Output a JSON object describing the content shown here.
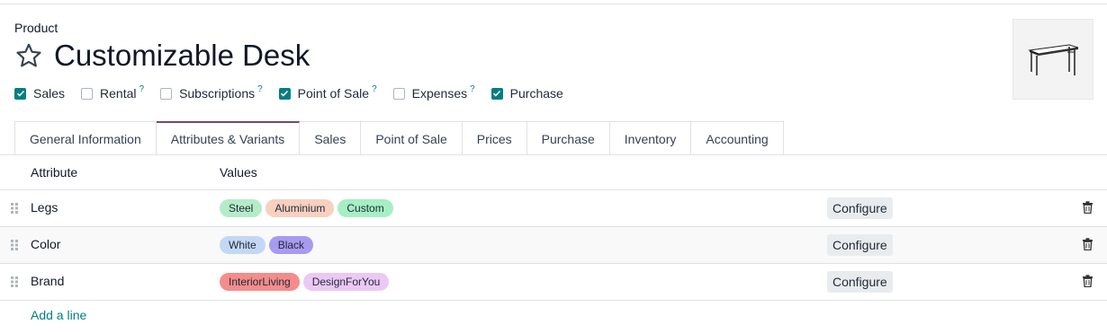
{
  "breadcrumb": "Product",
  "product": {
    "name": "Customizable Desk",
    "favorite_icon": "star-outline-icon",
    "image_icon": "desk-image"
  },
  "options": [
    {
      "label": "Sales",
      "checked": true,
      "help": ""
    },
    {
      "label": "Rental",
      "checked": false,
      "help": "?"
    },
    {
      "label": "Subscriptions",
      "checked": false,
      "help": "?"
    },
    {
      "label": "Point of Sale",
      "checked": true,
      "help": "?"
    },
    {
      "label": "Expenses",
      "checked": false,
      "help": "?"
    },
    {
      "label": "Purchase",
      "checked": true,
      "help": ""
    }
  ],
  "tabs": [
    {
      "label": "General Information",
      "active": false
    },
    {
      "label": "Attributes & Variants",
      "active": true
    },
    {
      "label": "Sales",
      "active": false
    },
    {
      "label": "Point of Sale",
      "active": false
    },
    {
      "label": "Prices",
      "active": false
    },
    {
      "label": "Purchase",
      "active": false
    },
    {
      "label": "Inventory",
      "active": false
    },
    {
      "label": "Accounting",
      "active": false
    }
  ],
  "table": {
    "headers": {
      "attribute": "Attribute",
      "values": "Values"
    },
    "rows": [
      {
        "attribute": "Legs",
        "values": [
          {
            "label": "Steel",
            "color": "#b5ecc8"
          },
          {
            "label": "Aluminium",
            "color": "#f8d0c0"
          },
          {
            "label": "Custom",
            "color": "#a6efc3"
          }
        ]
      },
      {
        "attribute": "Color",
        "values": [
          {
            "label": "White",
            "color": "#c3d8f5"
          },
          {
            "label": "Black",
            "color": "#a89af0"
          }
        ]
      },
      {
        "attribute": "Brand",
        "values": [
          {
            "label": "InteriorLiving",
            "color": "#f48c8c"
          },
          {
            "label": "DesignForYou",
            "color": "#ecc8f5"
          }
        ]
      }
    ],
    "configure_label": "Configure",
    "add_line": "Add a line"
  },
  "colors": {
    "accent": "#017e84",
    "active_tab": "#714b67"
  }
}
